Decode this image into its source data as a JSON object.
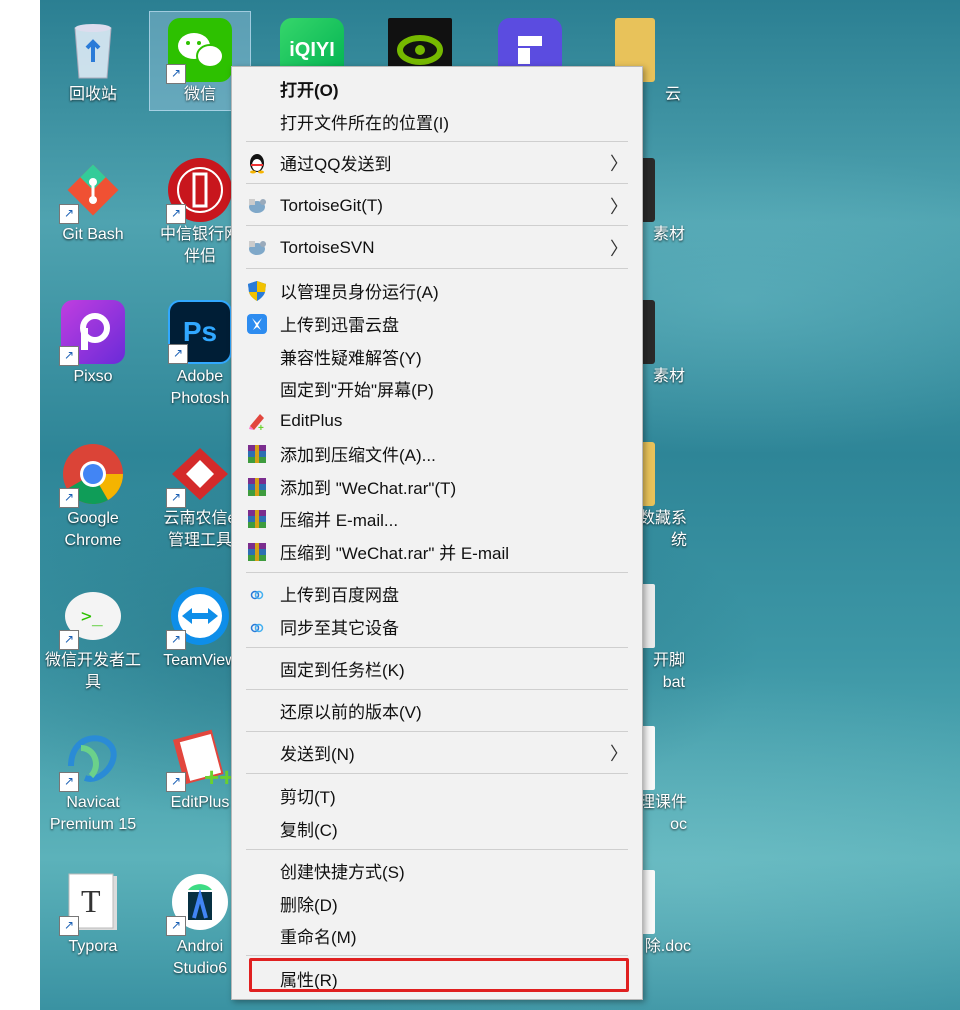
{
  "desktop": {
    "icons": [
      {
        "label": "回收站",
        "id": "recycle-bin"
      },
      {
        "label": "微信",
        "id": "wechat"
      },
      {
        "label": "iQIYI",
        "id": "iqiyi"
      },
      {
        "label": "",
        "id": "nvidia"
      },
      {
        "label": "",
        "id": "app-purple"
      },
      {
        "label": "云",
        "id": "cloud-folder"
      },
      {
        "label": "Git Bash",
        "id": "git-bash"
      },
      {
        "label": "中信银行网",
        "label2": "伴侣",
        "id": "citic-bank"
      },
      {
        "label": "素材",
        "id": "material-folder"
      },
      {
        "label": "Pixso",
        "id": "pixso"
      },
      {
        "label": "Adobe",
        "label2": "Photosh",
        "id": "photoshop"
      },
      {
        "label": "素材",
        "id": "material-folder-2"
      },
      {
        "label": "Google",
        "label2": "Chrome",
        "id": "chrome"
      },
      {
        "label": "云南农信e",
        "label2": "管理工具",
        "id": "yunnan-rural"
      },
      {
        "label": "数藏系",
        "label2": "统",
        "id": "collection-folder"
      },
      {
        "label": "微信开发者工",
        "label2": "具",
        "id": "wechat-devtools"
      },
      {
        "label": "TeamView",
        "id": "teamviewer"
      },
      {
        "label": "开脚",
        "label2": "bat",
        "id": "bat-file"
      },
      {
        "label": "Navicat",
        "label2": "Premium 15",
        "id": "navicat"
      },
      {
        "label": "EditPlus",
        "id": "editplus"
      },
      {
        "label": "理课件",
        "label2": "oc",
        "id": "courseware-doc"
      },
      {
        "label": "Typora",
        "id": "typora"
      },
      {
        "label": "Androi",
        "label2": "Studio6",
        "id": "android-studio"
      },
      {
        "label": "除.doc",
        "id": "doc-file"
      }
    ]
  },
  "menu": {
    "items": [
      {
        "label": "打开(O)",
        "bold": true
      },
      {
        "label": "打开文件所在的位置(I)"
      },
      {
        "label": "通过QQ发送到",
        "submenu": true,
        "icon": "qq-penguin-icon"
      },
      {
        "label": "TortoiseGit(T)",
        "submenu": true,
        "icon": "tortoise-git-icon"
      },
      {
        "label": "TortoiseSVN",
        "submenu": true,
        "icon": "tortoise-svn-icon"
      },
      {
        "label": "以管理员身份运行(A)",
        "icon": "uac-shield-icon"
      },
      {
        "label": "上传到迅雷云盘",
        "icon": "xunlei-icon"
      },
      {
        "label": "兼容性疑难解答(Y)"
      },
      {
        "label": "固定到\"开始\"屏幕(P)"
      },
      {
        "label": "EditPlus",
        "icon": "editplus-icon"
      },
      {
        "label": "添加到压缩文件(A)...",
        "icon": "winrar-icon"
      },
      {
        "label": "添加到 \"WeChat.rar\"(T)",
        "icon": "winrar-icon"
      },
      {
        "label": "压缩并 E-mail...",
        "icon": "winrar-icon"
      },
      {
        "label": "压缩到 \"WeChat.rar\" 并 E-mail",
        "icon": "winrar-icon"
      },
      {
        "label": "上传到百度网盘",
        "icon": "baidu-netdisk-icon"
      },
      {
        "label": "同步至其它设备",
        "icon": "baidu-netdisk-icon"
      },
      {
        "label": "固定到任务栏(K)"
      },
      {
        "label": "还原以前的版本(V)"
      },
      {
        "label": "发送到(N)",
        "submenu": true
      },
      {
        "label": "剪切(T)"
      },
      {
        "label": "复制(C)"
      },
      {
        "label": "创建快捷方式(S)"
      },
      {
        "label": "删除(D)"
      },
      {
        "label": "重命名(M)"
      },
      {
        "label": "属性(R)",
        "highlighted": true
      }
    ],
    "arrow_glyph": "〉"
  },
  "colors": {
    "highlight": "#e02020",
    "menu_bg": "#f2f2f2",
    "wechat": "#2dc100"
  }
}
